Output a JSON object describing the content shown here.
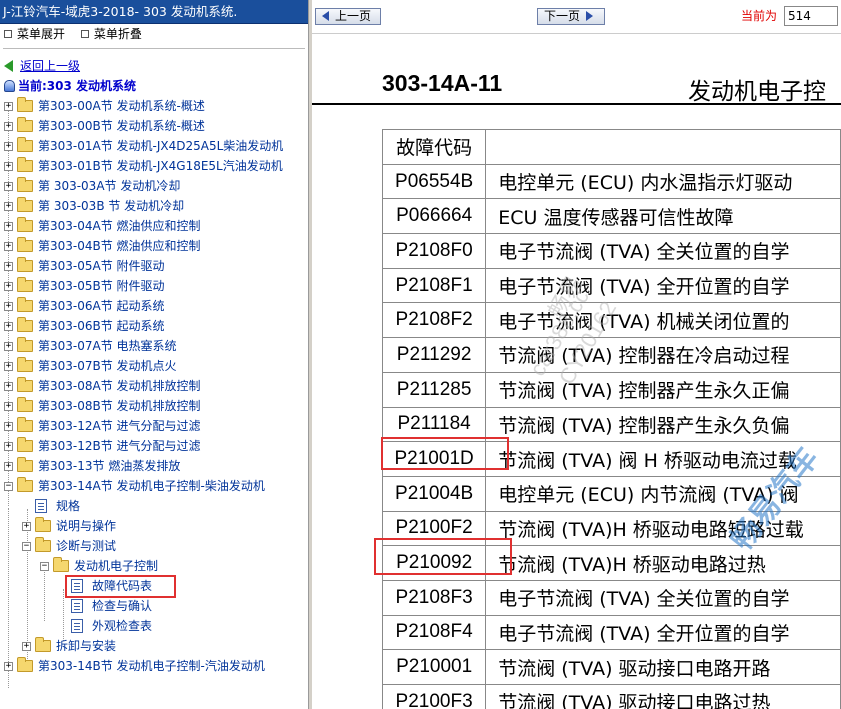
{
  "left": {
    "title": "J-江铃汽车-域虎3-2018- 303 发动机系统.",
    "menu_expand": "菜单展开",
    "menu_collapse": "菜单折叠",
    "back_link": "返回上一级",
    "current": "当前:303 发动机系统",
    "tree": [
      "第303-00A节 发动机系统-概述",
      "第303-00B节 发动机系统-概述",
      "第303-01A节 发动机-JX4D25A5L柴油发动机",
      "第303-01B节 发动机-JX4G18E5L汽油发动机",
      "第 303-03A节 发动机冷却",
      "第 303-03B 节 发动机冷却",
      "第303-04A节 燃油供应和控制",
      "第303-04B节 燃油供应和控制",
      "第303-05A节 附件驱动",
      "第303-05B节 附件驱动",
      "第303-06A节 起动系统",
      "第303-06B节 起动系统",
      "第303-07A节 电热塞系统",
      "第303-07B节 发动机点火",
      "第303-08A节 发动机排放控制",
      "第303-08B节 发动机排放控制",
      "第303-12A节 进气分配与过滤",
      "第303-12B节 进气分配与过滤",
      "第303-13节 燃油蒸发排放",
      "第303-14A节 发动机电子控制-柴油发动机"
    ],
    "sub": {
      "guige": "规格",
      "shuoming": "说明与操作",
      "zhenduan": "诊断与测试",
      "fdjdzkz": "发动机电子控制",
      "gzdmb": "故障代码表",
      "jcyqr": "检查与确认",
      "wgjcb": "外观检查表",
      "chaixie": "拆卸与安装",
      "last": "第303-14B节 发动机电子控制-汽油发动机"
    }
  },
  "right": {
    "prev": "上一页",
    "next": "下一页",
    "current_label": "当前为",
    "page_value": "514",
    "code": "303-14A-11",
    "title": "发动机电子控",
    "col_code": "故障代码",
    "col_desc": "",
    "rows": [
      {
        "code": "P06554B",
        "desc": "电控单元 (ECU) 内水温指示灯驱动"
      },
      {
        "code": "P066664",
        "desc": "ECU 温度传感器可信性故障"
      },
      {
        "code": "P2108F0",
        "desc": "电子节流阀 (TVA) 全关位置的自学"
      },
      {
        "code": "P2108F1",
        "desc": "电子节流阀 (TVA) 全开位置的自学"
      },
      {
        "code": "P2108F2",
        "desc": "电子节流阀 (TVA) 机械关闭位置的"
      },
      {
        "code": "P211292",
        "desc": "节流阀 (TVA) 控制器在冷启动过程"
      },
      {
        "code": "P211285",
        "desc": "节流阀 (TVA) 控制器产生永久正偏"
      },
      {
        "code": "P211184",
        "desc": "节流阀 (TVA) 控制器产生永久负偏"
      },
      {
        "code": "P21001D",
        "desc": "节流阀 (TVA) 阀 H 桥驱动电流过载"
      },
      {
        "code": "P21004B",
        "desc": "电控单元 (ECU) 内节流阀 (TVA) 阀"
      },
      {
        "code": "P2100F2",
        "desc": "节流阀 (TVA)H 桥驱动电路短路过载"
      },
      {
        "code": "P210092",
        "desc": "节流阀 (TVA)H 桥驱动电路过热"
      },
      {
        "code": "P2108F3",
        "desc": "电子节流阀 (TVA) 全关位置的自学"
      },
      {
        "code": "P2108F4",
        "desc": "电子节流阀 (TVA) 全开位置的自学"
      },
      {
        "code": "P210001",
        "desc": "节流阀 (TVA) 驱动接口电路开路"
      },
      {
        "code": "P2100F3",
        "desc": "节流阀 (TVA) 驱动接口电路过热"
      }
    ],
    "watermark1": "畅易",
    "watermark2": "car388.cc",
    "watermark3": "CY20162",
    "watermark4": "畅易汽车"
  }
}
